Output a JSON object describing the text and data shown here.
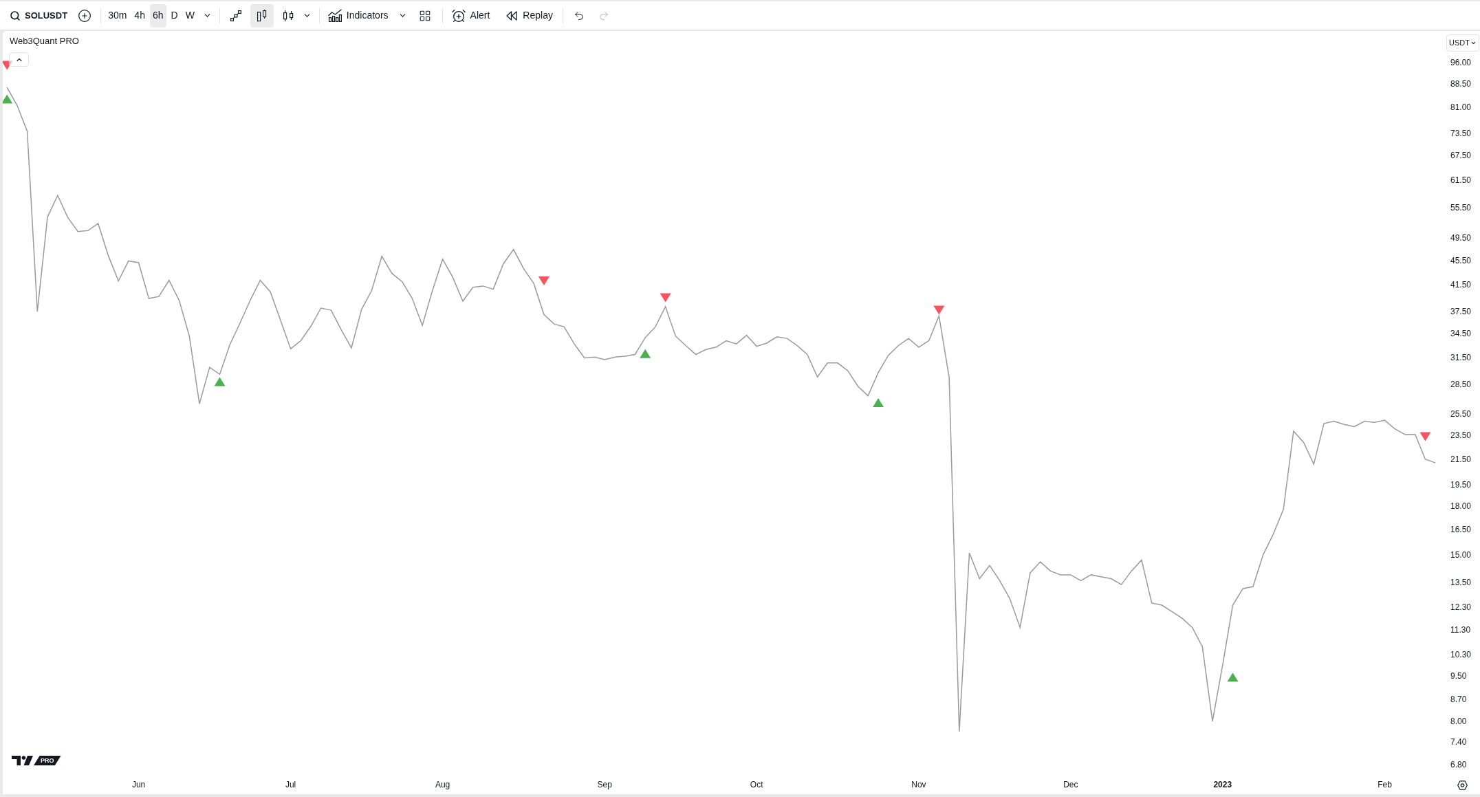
{
  "toolbar": {
    "symbol": "SOLUSDT",
    "intervals": [
      {
        "label": "30m",
        "selected": false
      },
      {
        "label": "4h",
        "selected": false
      },
      {
        "label": "6h",
        "selected": true
      },
      {
        "label": "D",
        "selected": false
      },
      {
        "label": "W",
        "selected": false
      }
    ],
    "chart_styles": [
      {
        "selected": false
      },
      {
        "selected": true
      },
      {
        "selected": false
      }
    ],
    "indicators_label": "Indicators",
    "alert_label": "Alert",
    "replay_label": "Replay",
    "undo": {
      "disabled": false
    },
    "redo": {
      "disabled": true
    }
  },
  "chart": {
    "legend": {
      "title": "Web3Quant PRO"
    },
    "currency": "USDT",
    "logo_badge": "PRO",
    "chart_data": {
      "type": "line",
      "log": true,
      "ylim": [
        6.8,
        96
      ],
      "categories": [
        null,
        null,
        null,
        null,
        null,
        null,
        null,
        null,
        null,
        null,
        null,
        null,
        null,
        "Jun",
        null,
        null,
        null,
        null,
        null,
        null,
        null,
        null,
        null,
        null,
        null,
        null,
        null,
        null,
        "Jul",
        null,
        null,
        null,
        null,
        null,
        null,
        null,
        null,
        null,
        null,
        null,
        null,
        null,
        null,
        "Aug",
        null,
        null,
        null,
        null,
        null,
        null,
        null,
        null,
        null,
        null,
        null,
        null,
        null,
        null,
        null,
        "Sep",
        null,
        null,
        null,
        null,
        null,
        null,
        null,
        null,
        null,
        null,
        null,
        null,
        null,
        null,
        "Oct",
        null,
        null,
        null,
        null,
        null,
        null,
        null,
        null,
        null,
        null,
        null,
        null,
        null,
        null,
        null,
        "Nov",
        null,
        null,
        null,
        null,
        null,
        null,
        null,
        null,
        null,
        null,
        null,
        null,
        null,
        null,
        "Dec",
        null,
        null,
        null,
        null,
        null,
        null,
        null,
        null,
        null,
        null,
        null,
        null,
        null,
        null,
        "**2023**",
        null,
        null,
        null,
        null,
        null,
        null,
        null,
        null,
        null,
        null,
        null,
        null,
        null,
        null,
        null,
        "Feb",
        null,
        null,
        null,
        null,
        null
      ],
      "series": [
        {
          "color": "#9a9a9a",
          "values": [
            87.3,
            81.6,
            74.0,
            37.5,
            53.6,
            58.1,
            53.5,
            50.7,
            50.9,
            52.3,
            46.3,
            42.1,
            45.4,
            45.1,
            39.4,
            39.7,
            42.2,
            39.1,
            34.2,
            26.5,
            30.4,
            29.6,
            33.1,
            35.9,
            39.1,
            42.2,
            40.4,
            36.3,
            32.6,
            33.6,
            35.5,
            38.0,
            37.7,
            35.0,
            32.7,
            37.8,
            40.6,
            46.2,
            43.3,
            42.0,
            39.4,
            35.6,
            40.6,
            45.7,
            42.7,
            39.0,
            41.1,
            41.3,
            40.8,
            44.9,
            47.4,
            44.1,
            41.7,
            37.1,
            35.8,
            35.4,
            33.2,
            31.5,
            31.6,
            31.3,
            31.6,
            31.7,
            31.9,
            34.0,
            35.4,
            38.2,
            34.2,
            33.0,
            31.9,
            32.5,
            32.8,
            33.6,
            33.2,
            34.3,
            32.9,
            33.3,
            34.1,
            33.9,
            33.0,
            31.9,
            29.3,
            30.9,
            30.9,
            30.0,
            28.3,
            27.3,
            29.8,
            31.8,
            33.0,
            33.9,
            32.8,
            33.6,
            36.9,
            29.3,
            7.7,
            15.1,
            13.7,
            14.4,
            13.6,
            12.7,
            11.4,
            14.0,
            14.6,
            14.1,
            13.9,
            13.9,
            13.6,
            13.9,
            13.8,
            13.7,
            13.4,
            14.1,
            14.7,
            12.5,
            12.4,
            12.1,
            11.8,
            11.4,
            10.6,
            8.0,
            9.9,
            12.4,
            13.2,
            13.3,
            15.0,
            16.2,
            17.8,
            23.9,
            22.9,
            21.1,
            24.6,
            24.8,
            24.5,
            24.3,
            24.8,
            24.7,
            24.9,
            24.1,
            23.6,
            23.6,
            21.5,
            21.2
          ]
        },
        {
          "type": "scatter",
          "color": "#f7525f",
          "values": [
            94.9,
            null,
            null,
            null,
            null,
            null,
            null,
            null,
            null,
            null,
            null,
            null,
            null,
            null,
            null,
            null,
            null,
            null,
            null,
            null,
            null,
            null,
            null,
            null,
            null,
            null,
            null,
            null,
            null,
            null,
            null,
            null,
            null,
            null,
            null,
            null,
            null,
            null,
            null,
            null,
            null,
            null,
            null,
            null,
            null,
            null,
            null,
            null,
            null,
            null,
            null,
            null,
            null,
            42.1,
            null,
            null,
            null,
            null,
            null,
            null,
            null,
            null,
            null,
            null,
            null,
            39.5,
            null,
            null,
            null,
            null,
            null,
            null,
            null,
            null,
            null,
            null,
            null,
            null,
            null,
            null,
            null,
            null,
            null,
            null,
            null,
            null,
            null,
            null,
            null,
            null,
            null,
            null,
            37.7,
            null,
            null,
            null,
            null,
            null,
            null,
            null,
            null,
            null,
            null,
            null,
            null,
            null,
            null,
            null,
            null,
            null,
            null,
            null,
            null,
            null,
            null,
            null,
            null,
            null,
            null,
            null,
            null,
            null,
            null,
            null,
            null,
            null,
            null,
            null,
            null,
            null,
            null,
            null,
            null,
            null,
            null,
            null,
            null,
            null,
            null,
            null,
            23.4,
            null
          ]
        },
        {
          "type": "scatter",
          "color": "#4caf50",
          "values": [
            83.6,
            null,
            null,
            null,
            null,
            null,
            null,
            null,
            null,
            null,
            null,
            null,
            null,
            null,
            null,
            null,
            null,
            null,
            null,
            null,
            null,
            28.8,
            null,
            null,
            null,
            null,
            null,
            null,
            null,
            null,
            null,
            null,
            null,
            null,
            null,
            null,
            null,
            null,
            null,
            null,
            null,
            null,
            null,
            null,
            null,
            null,
            null,
            null,
            null,
            null,
            null,
            null,
            null,
            null,
            null,
            null,
            null,
            null,
            null,
            null,
            null,
            null,
            null,
            32.0,
            null,
            null,
            null,
            null,
            null,
            null,
            null,
            null,
            null,
            null,
            null,
            null,
            null,
            null,
            null,
            null,
            null,
            null,
            null,
            null,
            null,
            null,
            26.6,
            null,
            null,
            null,
            null,
            null,
            null,
            null,
            null,
            null,
            null,
            null,
            null,
            null,
            null,
            null,
            null,
            null,
            null,
            null,
            null,
            null,
            null,
            null,
            null,
            null,
            null,
            null,
            null,
            null,
            null,
            null,
            null,
            null,
            null,
            9.45,
            null,
            null,
            null,
            null,
            null,
            null,
            null,
            null,
            null,
            null,
            null,
            null,
            null,
            null,
            null,
            null,
            null,
            null,
            null,
            null
          ]
        }
      ],
      "yticks": [
        {
          "value": 96,
          "label": "96.00"
        },
        {
          "value": 88.5,
          "label": "88.50"
        },
        {
          "value": 81,
          "label": "81.00"
        },
        {
          "value": 73.5,
          "label": "73.50"
        },
        {
          "value": 67.5,
          "label": "67.50"
        },
        {
          "value": 61.5,
          "label": "61.50"
        },
        {
          "value": 55.5,
          "label": "55.50"
        },
        {
          "value": 49.5,
          "label": "49.50"
        },
        {
          "value": 45.5,
          "label": "45.50"
        },
        {
          "value": 41.5,
          "label": "41.50"
        },
        {
          "value": 37.5,
          "label": "37.50"
        },
        {
          "value": 34.5,
          "label": "34.50"
        },
        {
          "value": 31.5,
          "label": "31.50"
        },
        {
          "value": 28.5,
          "label": "28.50"
        },
        {
          "value": 25.5,
          "label": "25.50"
        },
        {
          "value": 23.5,
          "label": "23.50"
        },
        {
          "value": 21.5,
          "label": "21.50"
        },
        {
          "value": 19.5,
          "label": "19.50"
        },
        {
          "value": 18,
          "label": "18.00"
        },
        {
          "value": 16.5,
          "label": "16.50"
        },
        {
          "value": 15,
          "label": "15.00"
        },
        {
          "value": 13.5,
          "label": "13.50"
        },
        {
          "value": 12.3,
          "label": "12.30"
        },
        {
          "value": 11.3,
          "label": "11.30"
        },
        {
          "value": 10.3,
          "label": "10.30"
        },
        {
          "value": 9.5,
          "label": "9.50"
        },
        {
          "value": 8.7,
          "label": "8.70"
        },
        {
          "value": 8,
          "label": "8.00"
        },
        {
          "value": 7.4,
          "label": "7.40"
        },
        {
          "value": 6.8,
          "label": "6.80"
        }
      ]
    }
  }
}
